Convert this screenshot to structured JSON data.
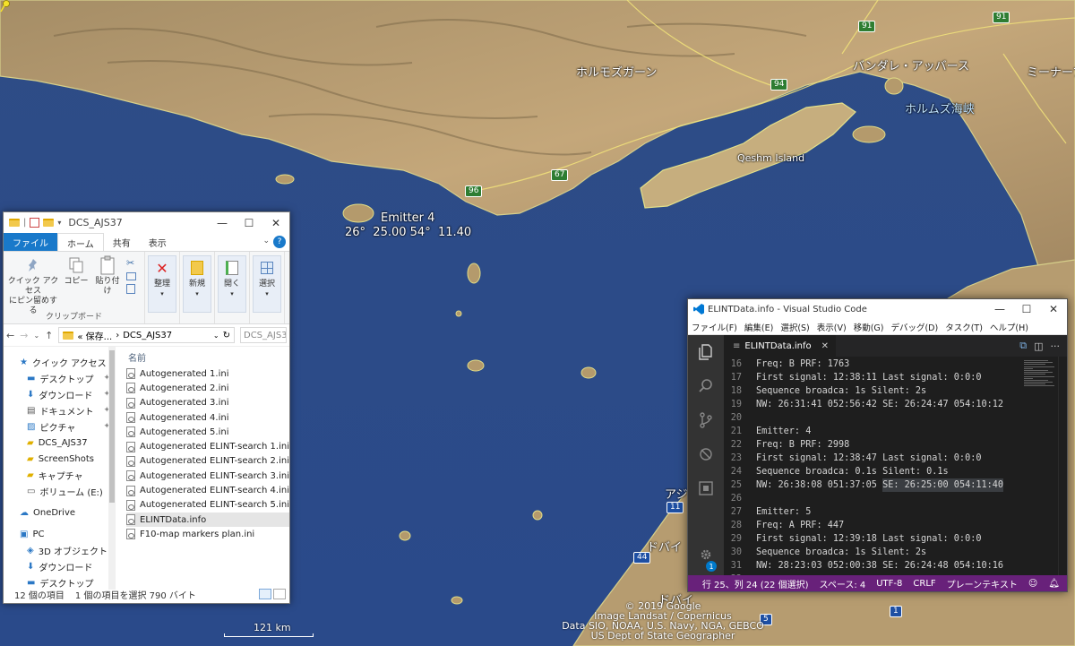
{
  "map": {
    "labels": {
      "hormozgan": "ホルモズガーン",
      "bandar_abbas": "バンダレ・アッバース",
      "minab": "ミーナーブ",
      "hormuz_strait": "ホルムズ海峡",
      "qeshm": "Qeshm Island",
      "dubai_top": "アジ",
      "dubai": "ドバイ",
      "dubai2": "ドバイ"
    },
    "roads": {
      "r91a": "91",
      "r91b": "91",
      "r94": "94",
      "r67": "67",
      "r96": "96",
      "r11": "11",
      "r44": "44",
      "r5": "5",
      "r1": "1"
    },
    "emitter": {
      "name": "Emitter 4",
      "coords": "26°  25.00 54°  11.40"
    },
    "attribution": {
      "line1": "© 2019 Google",
      "line2": "Image Landsat / Copernicus",
      "line3": "Data SIO, NOAA, U.S. Navy, NGA, GEBCO",
      "line4": "US Dept of State Geographer"
    },
    "scale": "121 km",
    "colors": {
      "sea": "#2f4f86",
      "land": "#b89c6e"
    }
  },
  "explorer": {
    "title": "DCS_AJS37",
    "tabs": {
      "file": "ファイル",
      "home": "ホーム",
      "share": "共有",
      "view": "表示"
    },
    "ribbon": {
      "quick_access": "クイック アクセス\nにピン留めする",
      "copy": "コピー",
      "paste": "貼り付け",
      "clipboard": "クリップボード",
      "organize": "整理",
      "new": "新規",
      "open": "開く",
      "select": "選択"
    },
    "address": {
      "part1": "« 保存...",
      "sep": "›",
      "part2": "DCS_AJS37",
      "search": "DCS_AJS3..."
    },
    "column_name": "名前",
    "nav": [
      {
        "label": "クイック アクセス",
        "icon": "star-icon",
        "pinned": false
      },
      {
        "label": "デスクトップ",
        "icon": "desktop-icon",
        "pinned": true
      },
      {
        "label": "ダウンロード",
        "icon": "download-icon",
        "pinned": true
      },
      {
        "label": "ドキュメント",
        "icon": "documents-icon",
        "pinned": true
      },
      {
        "label": "ピクチャ",
        "icon": "pictures-icon",
        "pinned": true
      },
      {
        "label": "DCS_AJS37",
        "icon": "folder-icon",
        "pinned": false
      },
      {
        "label": "ScreenShots",
        "icon": "folder-icon",
        "pinned": false
      },
      {
        "label": "キャプチャ",
        "icon": "folder-icon",
        "pinned": false
      },
      {
        "label": "ボリューム (E:)",
        "icon": "drive-icon",
        "pinned": false
      },
      {
        "label": "OneDrive",
        "icon": "cloud-icon",
        "pinned": false
      },
      {
        "label": "PC",
        "icon": "pc-icon",
        "pinned": false
      },
      {
        "label": "3D オブジェクト",
        "icon": "cube-icon",
        "pinned": false
      },
      {
        "label": "ダウンロード",
        "icon": "download-icon",
        "pinned": false
      },
      {
        "label": "デスクトップ",
        "icon": "desktop-icon",
        "pinned": false
      }
    ],
    "files": [
      "Autogenerated 1.ini",
      "Autogenerated 2.ini",
      "Autogenerated 3.ini",
      "Autogenerated 4.ini",
      "Autogenerated 5.ini",
      "Autogenerated ELINT-search 1.ini",
      "Autogenerated ELINT-search 2.ini",
      "Autogenerated ELINT-search 3.ini",
      "Autogenerated ELINT-search 4.ini",
      "Autogenerated ELINT-search 5.ini",
      "ELINTData.info",
      "F10-map markers plan.ini"
    ],
    "selected_file_index": 10,
    "status": {
      "count": "12 個の項目",
      "selected": "1 個の項目を選択  790 バイト"
    }
  },
  "vscode": {
    "title": "ELINTData.info - Visual Studio Code",
    "menu": [
      "ファイル(F)",
      "編集(E)",
      "選択(S)",
      "表示(V)",
      "移動(G)",
      "デバッグ(D)",
      "タスク(T)",
      "ヘルプ(H)"
    ],
    "tab": "ELINTData.info",
    "badge": "1",
    "lines": [
      {
        "n": "16",
        "t": "Freq: B PRF: 1763",
        "sel": ""
      },
      {
        "n": "17",
        "t": "First signal: 12:38:11 Last signal: 0:0:0",
        "sel": ""
      },
      {
        "n": "18",
        "t": "Sequence broadca: 1s Silent: 2s",
        "sel": ""
      },
      {
        "n": "19",
        "t": "NW: 26:31:41 052:56:42 SE: 26:24:47 054:10:12",
        "sel": ""
      },
      {
        "n": "20",
        "t": "",
        "sel": ""
      },
      {
        "n": "21",
        "t": "Emitter: 4",
        "sel": ""
      },
      {
        "n": "22",
        "t": "Freq: B PRF: 2998",
        "sel": ""
      },
      {
        "n": "23",
        "t": "First signal: 12:38:47 Last signal: 0:0:0",
        "sel": ""
      },
      {
        "n": "24",
        "t": "Sequence broadca: 0.1s Silent: 0.1s",
        "sel": ""
      },
      {
        "n": "25",
        "t": "NW: 26:38:08 051:37:05 ",
        "sel": "SE: 26:25:00 054:11:40"
      },
      {
        "n": "26",
        "t": "",
        "sel": ""
      },
      {
        "n": "27",
        "t": "Emitter: 5",
        "sel": ""
      },
      {
        "n": "28",
        "t": "Freq: A PRF: 447",
        "sel": ""
      },
      {
        "n": "29",
        "t": "First signal: 12:39:18 Last signal: 0:0:0",
        "sel": ""
      },
      {
        "n": "30",
        "t": "Sequence broadca: 1s Silent: 2s",
        "sel": ""
      },
      {
        "n": "31",
        "t": "NW: 28:23:03 052:00:38 SE: 26:24:48 054:10:16",
        "sel": ""
      },
      {
        "n": "32",
        "t": "",
        "sel": ""
      }
    ],
    "status": {
      "position": "行 25、列 24 (22 個選択)",
      "spaces": "スペース: 4",
      "encoding": "UTF-8",
      "eol": "CRLF",
      "language": "プレーンテキスト"
    },
    "colors": {
      "statusbar": "#68217a",
      "editor": "#1e1e1e",
      "activity": "#333333"
    }
  }
}
